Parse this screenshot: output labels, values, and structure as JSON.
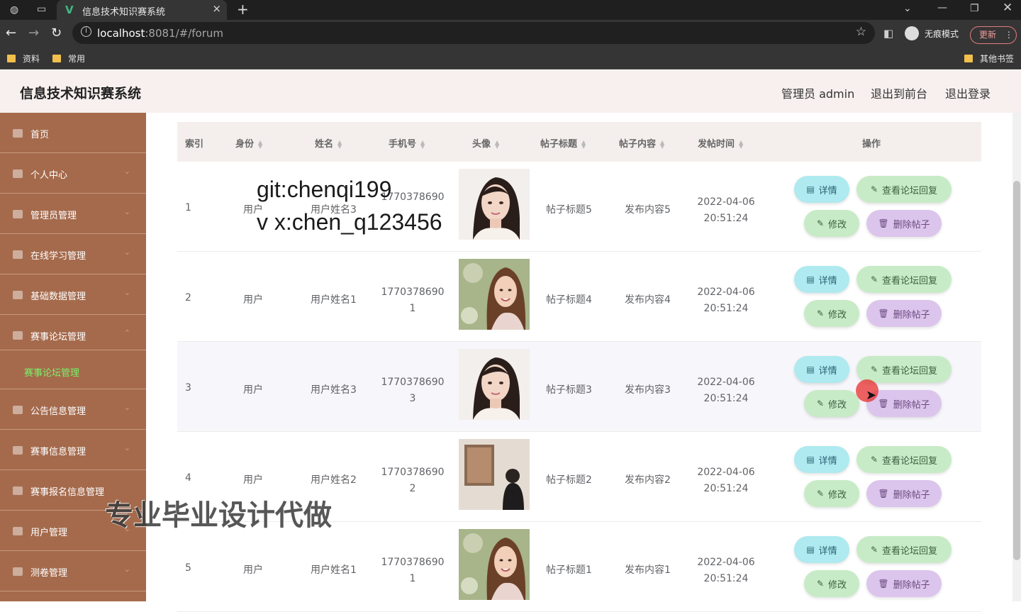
{
  "browser": {
    "tab_title": "信息技术知识赛系统",
    "url_host": "localhost",
    "url_rest": ":8081/#/forum",
    "incognito_label": "无痕模式",
    "update_label": "更新",
    "bookmarks": [
      "资料",
      "常用"
    ],
    "other_bookmarks": "其他书签"
  },
  "header": {
    "title": "信息技术知识赛系统",
    "admin": "管理员 admin",
    "to_front": "退出到前台",
    "logout": "退出登录"
  },
  "sidebar": {
    "items": [
      {
        "label": "首页"
      },
      {
        "label": "个人中心"
      },
      {
        "label": "管理员管理"
      },
      {
        "label": "在线学习管理"
      },
      {
        "label": "基础数据管理"
      },
      {
        "label": "赛事论坛管理"
      },
      {
        "label": "公告信息管理"
      },
      {
        "label": "赛事信息管理"
      },
      {
        "label": "赛事报名信息管理"
      },
      {
        "label": "用户管理"
      },
      {
        "label": "测卷管理"
      }
    ],
    "active_sub": "赛事论坛管理"
  },
  "table": {
    "headers": [
      "索引",
      "身份",
      "姓名",
      "手机号",
      "头像",
      "帖子标题",
      "帖子内容",
      "发帖时间",
      "操作"
    ],
    "buttons": {
      "detail": "详情",
      "reply": "查看论坛回复",
      "edit": "修改",
      "delete": "删除帖子"
    },
    "rows": [
      {
        "index": "1",
        "role": "用户",
        "name": "用户姓名3",
        "phone1": "1770378690",
        "phone2": "",
        "title": "帖子标题5",
        "content": "发布内容5",
        "date": "2022-04-06",
        "time": "20:51:24",
        "avatar": "portrait-a"
      },
      {
        "index": "2",
        "role": "用户",
        "name": "用户姓名1",
        "phone1": "1770378690",
        "phone2": "1",
        "title": "帖子标题4",
        "content": "发布内容4",
        "date": "2022-04-06",
        "time": "20:51:24",
        "avatar": "portrait-b"
      },
      {
        "index": "3",
        "role": "用户",
        "name": "用户姓名3",
        "phone1": "1770378690",
        "phone2": "3",
        "title": "帖子标题3",
        "content": "发布内容3",
        "date": "2022-04-06",
        "time": "20:51:24",
        "avatar": "portrait-a"
      },
      {
        "index": "4",
        "role": "用户",
        "name": "用户姓名2",
        "phone1": "1770378690",
        "phone2": "2",
        "title": "帖子标题2",
        "content": "发布内容2",
        "date": "2022-04-06",
        "time": "20:51:24",
        "avatar": "portrait-c"
      },
      {
        "index": "5",
        "role": "用户",
        "name": "用户姓名1",
        "phone1": "1770378690",
        "phone2": "1",
        "title": "帖子标题1",
        "content": "发布内容1",
        "date": "2022-04-06",
        "time": "20:51:24",
        "avatar": "portrait-b"
      }
    ]
  },
  "watermarks": {
    "line1": "git:chenqi199",
    "line2": "v x:chen_q123456",
    "banner": "专业毕业设计代做"
  }
}
